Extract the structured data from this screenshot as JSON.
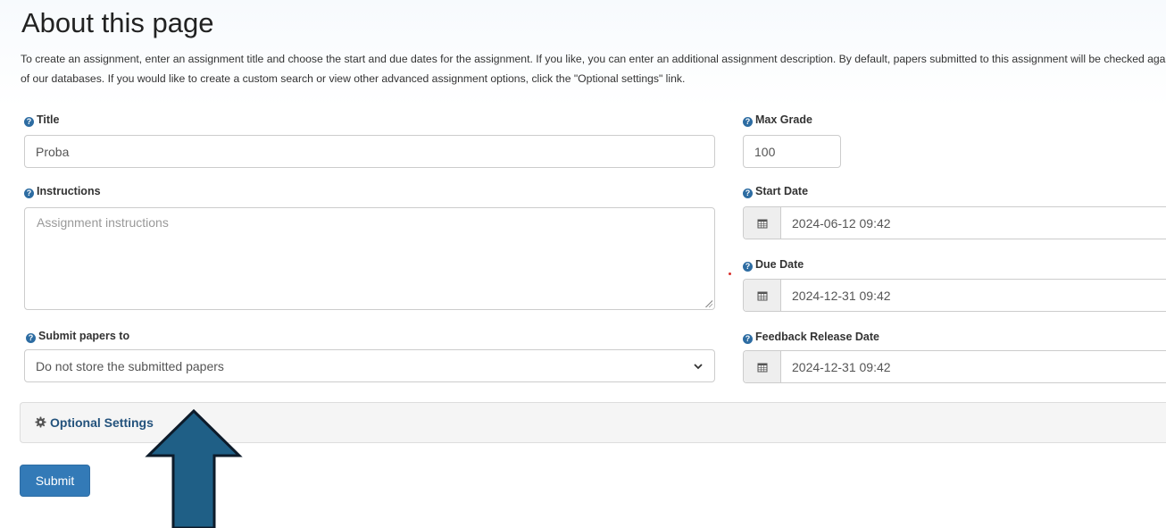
{
  "page": {
    "title": "About this page",
    "description": "To create an assignment, enter an assignment title and choose the start and due dates for the assignment. If you like, you can enter an additional assignment description. By default, papers submitted to this assignment will be checked against all of our databases. If you would like to create a custom search or view other advanced assignment options, click the \"Optional settings\" link."
  },
  "form": {
    "title": {
      "label": "Title",
      "value": "Proba"
    },
    "max_grade": {
      "label": "Max Grade",
      "value": "100"
    },
    "instructions": {
      "label": "Instructions",
      "placeholder": "Assignment instructions"
    },
    "start_date": {
      "label": "Start Date",
      "value": "2024-06-12 09:42"
    },
    "due_date": {
      "label": "Due Date",
      "value": "2024-12-31 09:42"
    },
    "submit_papers_to": {
      "label": "Submit papers to",
      "selected": "Do not store the submitted papers"
    },
    "feedback_release_date": {
      "label": "Feedback Release Date",
      "value": "2024-12-31 09:42"
    }
  },
  "optional_settings": {
    "label": "Optional Settings"
  },
  "actions": {
    "submit_label": "Submit"
  },
  "icons": {
    "help": "question-circle-icon",
    "calendar": "calendar-icon",
    "gear": "gear-icon",
    "chevron": "chevron-down-icon",
    "annotation": "arrow-up-annotation"
  },
  "colors": {
    "primary": "#337ab7",
    "link": "#23527c",
    "help_icon": "#2d6ca2",
    "arrow_fill": "#1f5f86",
    "arrow_stroke": "#0d1b2a"
  }
}
